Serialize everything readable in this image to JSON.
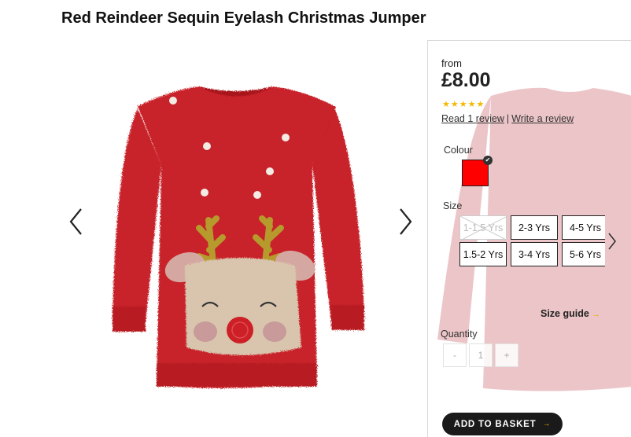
{
  "product": {
    "title": "Red Reindeer Sequin Eyelash Christmas Jumper"
  },
  "gallery": {
    "prev_icon": "chevron-left-icon",
    "next_icon": "chevron-right-icon"
  },
  "buy_panel": {
    "from_label": "from",
    "price": "£8.00",
    "rating": {
      "stars_filled": 5,
      "stars_total": 5,
      "star_glyph": "★"
    },
    "read_reviews": "Read 1 review",
    "separator": "|",
    "write_review": "Write a review",
    "colour_label": "Colour",
    "colour": {
      "hex": "#ff0000",
      "selected": true
    },
    "size_label": "Size",
    "sizes": [
      {
        "label": "1-1.5 Yrs",
        "available": false
      },
      {
        "label": "2-3 Yrs",
        "available": true
      },
      {
        "label": "4-5 Yrs",
        "available": true
      },
      {
        "label": "1.5-2 Yrs",
        "available": true
      },
      {
        "label": "3-4 Yrs",
        "available": true
      },
      {
        "label": "5-6 Yrs",
        "available": true
      }
    ],
    "size_guide": "Size guide",
    "size_guide_arrow": "→",
    "quantity_label": "Quantity",
    "quantity": {
      "minus": "-",
      "value": "1",
      "plus": "+"
    },
    "add_to_basket": "ADD TO BASKET",
    "add_arrow": "→"
  },
  "colors": {
    "sweater": "#c8202a",
    "accent": "#f2a900",
    "button": "#1a1a1a"
  }
}
